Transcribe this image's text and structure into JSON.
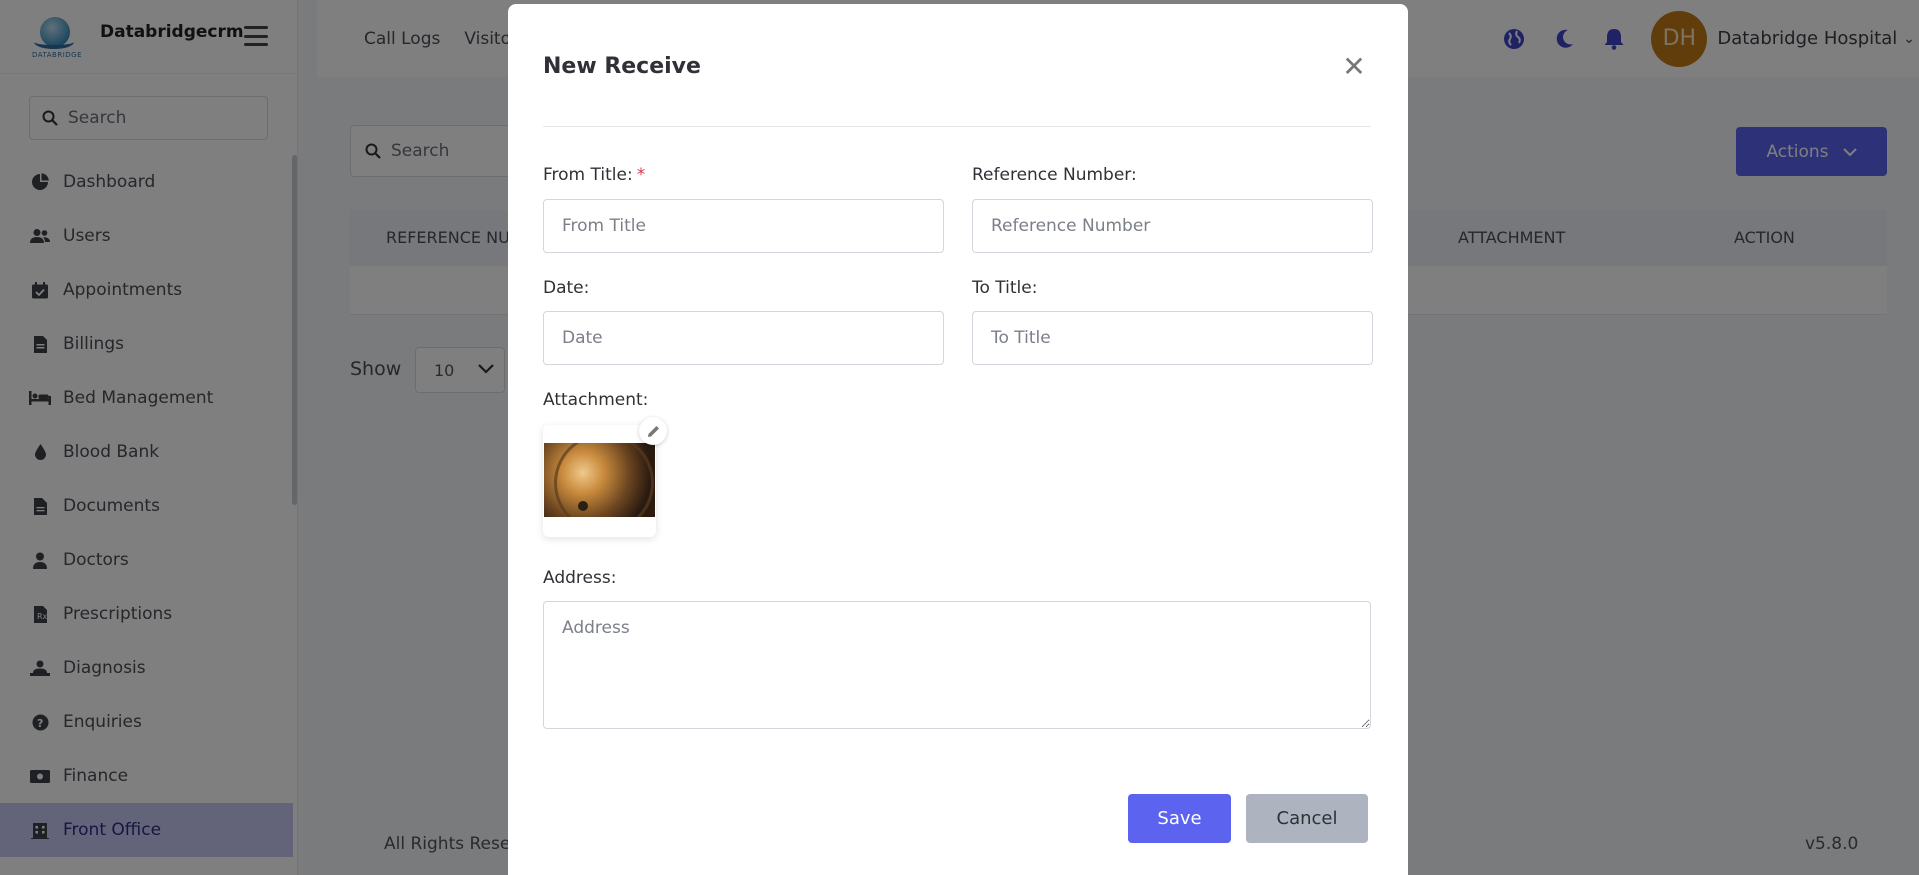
{
  "brand": {
    "name": "Databridgecrm",
    "logo_text": "DATABRIDGE"
  },
  "sidebar": {
    "search_placeholder": "Search",
    "items": [
      {
        "label": "Dashboard",
        "icon": "pie-chart-icon"
      },
      {
        "label": "Users",
        "icon": "users-icon"
      },
      {
        "label": "Appointments",
        "icon": "calendar-check-icon"
      },
      {
        "label": "Billings",
        "icon": "file-invoice-icon"
      },
      {
        "label": "Bed Management",
        "icon": "bed-icon"
      },
      {
        "label": "Blood Bank",
        "icon": "droplet-icon"
      },
      {
        "label": "Documents",
        "icon": "document-icon"
      },
      {
        "label": "Doctors",
        "icon": "doctor-icon"
      },
      {
        "label": "Prescriptions",
        "icon": "prescription-icon"
      },
      {
        "label": "Diagnosis",
        "icon": "diagnosis-icon"
      },
      {
        "label": "Enquiries",
        "icon": "question-circle-icon"
      },
      {
        "label": "Finance",
        "icon": "money-icon"
      },
      {
        "label": "Front Office",
        "icon": "building-icon",
        "active": true
      }
    ]
  },
  "topbar": {
    "links": [
      "Call Logs",
      "Visito"
    ],
    "user_initials": "DH",
    "user_name": "Databridge Hospital"
  },
  "page": {
    "search_placeholder": "Search",
    "actions_label": "Actions",
    "table_headers": [
      "REFERENCE NUM",
      "ATTACHMENT",
      "ACTION"
    ],
    "show_label": "Show",
    "show_value": "10",
    "footer_left": "All Rights Reser",
    "version": "v5.8.0"
  },
  "modal": {
    "title": "New Receive",
    "from_title_label": "From Title:",
    "from_title_required": "*",
    "from_title_placeholder": "From Title",
    "reference_label": "Reference Number:",
    "reference_placeholder": "Reference Number",
    "date_label": "Date:",
    "date_placeholder": "Date",
    "to_title_label": "To Title:",
    "to_title_placeholder": "To Title",
    "attachment_label": "Attachment:",
    "address_label": "Address:",
    "address_placeholder": "Address",
    "save_label": "Save",
    "cancel_label": "Cancel"
  },
  "colors": {
    "primary": "#5b63ef",
    "active_nav_bg": "#c6c8f2",
    "avatar_bg": "#c07a14",
    "cancel_bg": "#adb4bf",
    "required": "#e0344f"
  }
}
